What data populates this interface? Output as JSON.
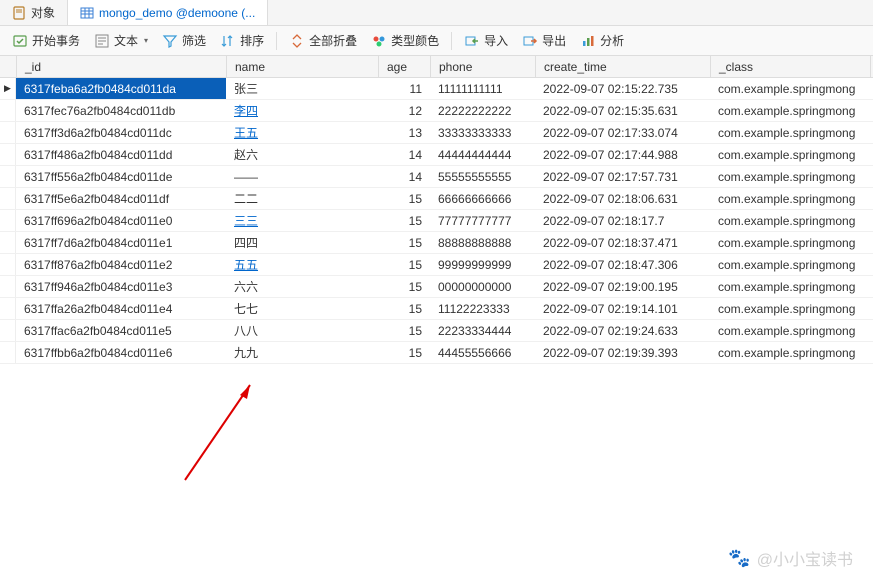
{
  "tabs": [
    {
      "label": "对象",
      "icon": "book"
    },
    {
      "label": "mongo_demo @demoone (...",
      "icon": "table",
      "active": true
    }
  ],
  "toolbar": {
    "start_transaction": "开始事务",
    "text": "文本",
    "filter": "筛选",
    "sort": "排序",
    "collapse_all": "全部折叠",
    "type_color": "类型颜色",
    "import": "导入",
    "export": "导出",
    "analyze": "分析"
  },
  "columns": [
    "_id",
    "name",
    "age",
    "phone",
    "create_time",
    "_class"
  ],
  "rows": [
    {
      "id": "6317feba6a2fb0484cd011da",
      "name": "张三",
      "age": 11,
      "phone": "11111111111",
      "time": "2022-09-07 02:15:22.735",
      "class": "com.example.springmong",
      "current": true,
      "selected": true
    },
    {
      "id": "6317fec76a2fb0484cd011db",
      "name": "李四",
      "age": 12,
      "phone": "22222222222",
      "time": "2022-09-07 02:15:35.631",
      "class": "com.example.springmong",
      "link": true
    },
    {
      "id": "6317ff3d6a2fb0484cd011dc",
      "name": "王五",
      "age": 13,
      "phone": "33333333333",
      "time": "2022-09-07 02:17:33.074",
      "class": "com.example.springmong",
      "link": true
    },
    {
      "id": "6317ff486a2fb0484cd011dd",
      "name": "赵六",
      "age": 14,
      "phone": "44444444444",
      "time": "2022-09-07 02:17:44.988",
      "class": "com.example.springmong"
    },
    {
      "id": "6317ff556a2fb0484cd011de",
      "name": "——",
      "age": 14,
      "phone": "55555555555",
      "time": "2022-09-07 02:17:57.731",
      "class": "com.example.springmong"
    },
    {
      "id": "6317ff5e6a2fb0484cd011df",
      "name": "二二",
      "age": 15,
      "phone": "66666666666",
      "time": "2022-09-07 02:18:06.631",
      "class": "com.example.springmong"
    },
    {
      "id": "6317ff696a2fb0484cd011e0",
      "name": "三三",
      "age": 15,
      "phone": "77777777777",
      "time": "2022-09-07 02:18:17.7",
      "class": "com.example.springmong",
      "link": true
    },
    {
      "id": "6317ff7d6a2fb0484cd011e1",
      "name": "四四",
      "age": 15,
      "phone": "88888888888",
      "time": "2022-09-07 02:18:37.471",
      "class": "com.example.springmong"
    },
    {
      "id": "6317ff876a2fb0484cd011e2",
      "name": "五五",
      "age": 15,
      "phone": "99999999999",
      "time": "2022-09-07 02:18:47.306",
      "class": "com.example.springmong",
      "link": true
    },
    {
      "id": "6317ff946a2fb0484cd011e3",
      "name": "六六",
      "age": 15,
      "phone": "00000000000",
      "time": "2022-09-07 02:19:00.195",
      "class": "com.example.springmong"
    },
    {
      "id": "6317ffa26a2fb0484cd011e4",
      "name": "七七",
      "age": 15,
      "phone": "11122223333",
      "time": "2022-09-07 02:19:14.101",
      "class": "com.example.springmong"
    },
    {
      "id": "6317ffac6a2fb0484cd011e5",
      "name": "八八",
      "age": 15,
      "phone": "22233334444",
      "time": "2022-09-07 02:19:24.633",
      "class": "com.example.springmong"
    },
    {
      "id": "6317ffbb6a2fb0484cd011e6",
      "name": "九九",
      "age": 15,
      "phone": "44455556666",
      "time": "2022-09-07 02:19:39.393",
      "class": "com.example.springmong"
    }
  ],
  "watermark": "@小小宝读书"
}
